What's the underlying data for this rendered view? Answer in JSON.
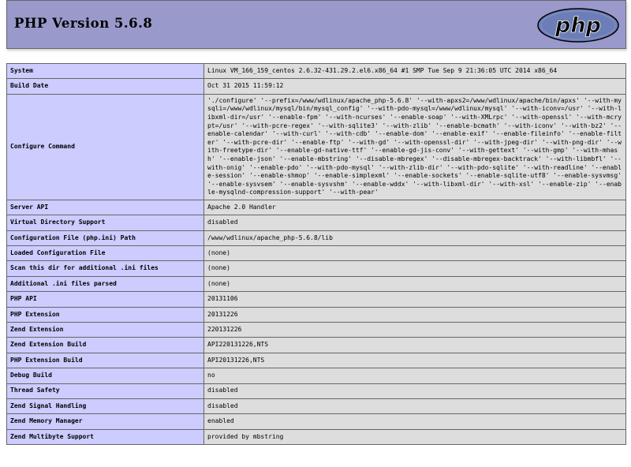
{
  "header": {
    "title": "PHP Version 5.6.8",
    "logo_text": "php",
    "colors": {
      "header_bg": "#9999cc",
      "label_bg": "#ccccff",
      "value_bg": "#dddddd",
      "border": "#666666"
    }
  },
  "rows": [
    {
      "label": "System",
      "value": "Linux VM_166_159_centos 2.6.32-431.29.2.el6.x86_64 #1 SMP Tue Sep 9 21:36:05 UTC 2014 x86_64"
    },
    {
      "label": "Build Date",
      "value": "Oct 31 2015 11:59:12"
    },
    {
      "label": "Configure Command",
      "value": "'./configure' '--prefix=/www/wdlinux/apache_php-5.6.8' '--with-apxs2=/www/wdlinux/apache/bin/apxs' '--with-mysqli=/www/wdlinux/mysql/bin/mysql_config' '--with-pdo-mysql=/www/wdlinux/mysql' '--with-iconv=/usr' '--with-libxml-dir=/usr' '--enable-fpm' '--with-ncurses' '--enable-soap' '--with-XMLrpc' '--with-openssl' '--with-mcrypt=/usr' '--with-pcre-regex' '--with-sqlite3' '--with-zlib' '--enable-bcmath' '--with-iconv' '--with-bz2' '--enable-calendar' '--with-curl' '--with-cdb' '--enable-dom' '--enable-exif' '--enable-fileinfo' '--enable-filter' '--with-pcre-dir' '--enable-ftp' '--with-gd' '--with-openssl-dir' '--with-jpeg-dir' '--with-png-dir' '--with-freetype-dir' '--enable-gd-native-ttf' '--enable-gd-jis-conv' '--with-gettext' '--with-gmp' '--with-mhash' '--enable-json' '--enable-mbstring' '--disable-mbregex' '--disable-mbregex-backtrack' '--with-libmbfl' '--with-onig' '--enable-pdo' '--with-pdo-mysql' '--with-zlib-dir' '--with-pdo-sqlite' '--with-readline' '--enable-session' '--enable-shmop' '--enable-simplexml' '--enable-sockets' '--enable-sqlite-utf8' '--enable-sysvmsg' '--enable-sysvsem' '--enable-sysvshm' '--enable-wddx' '--with-libxml-dir' '--with-xsl' '--enable-zip' '--enable-mysqlnd-compression-support' '--with-pear'"
    },
    {
      "label": "Server API",
      "value": "Apache 2.0 Handler"
    },
    {
      "label": "Virtual Directory Support",
      "value": "disabled"
    },
    {
      "label": "Configuration File (php.ini) Path",
      "value": "/www/wdlinux/apache_php-5.6.8/lib"
    },
    {
      "label": "Loaded Configuration File",
      "value": "(none)"
    },
    {
      "label": "Scan this dir for additional .ini files",
      "value": "(none)"
    },
    {
      "label": "Additional .ini files parsed",
      "value": "(none)"
    },
    {
      "label": "PHP API",
      "value": "20131106"
    },
    {
      "label": "PHP Extension",
      "value": "20131226"
    },
    {
      "label": "Zend Extension",
      "value": "220131226"
    },
    {
      "label": "Zend Extension Build",
      "value": "API220131226,NTS"
    },
    {
      "label": "PHP Extension Build",
      "value": "API20131226,NTS"
    },
    {
      "label": "Debug Build",
      "value": "no"
    },
    {
      "label": "Thread Safety",
      "value": "disabled"
    },
    {
      "label": "Zend Signal Handling",
      "value": "disabled"
    },
    {
      "label": "Zend Memory Manager",
      "value": "enabled"
    },
    {
      "label": "Zend Multibyte Support",
      "value": "provided by mbstring"
    }
  ]
}
